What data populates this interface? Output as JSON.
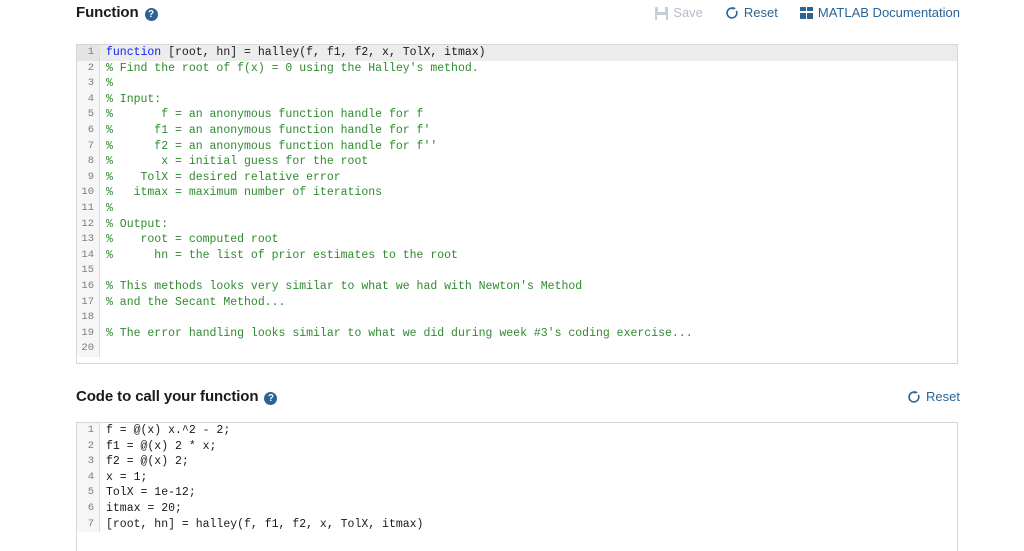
{
  "function_section": {
    "title": "Function",
    "help_icon": "help-circle-icon",
    "toolbar": {
      "save": {
        "label": "Save",
        "icon": "save-floppy-icon",
        "enabled": false
      },
      "reset": {
        "label": "Reset",
        "icon": "reset-circular-arrow-icon",
        "enabled": true
      },
      "docs": {
        "label": "MATLAB Documentation",
        "icon": "matlab-documentation-grid-icon",
        "enabled": true
      }
    },
    "accent_color": "#2a6496",
    "disabled_color": "#b3bfc9",
    "editor": {
      "active_line": 1,
      "lines": [
        {
          "n": "1",
          "tokens": [
            {
              "t": "function",
              "c": "kw"
            },
            {
              "t": " [root, hn] = halley(f, f1, f2, x, TolX, itmax)",
              "c": "txt"
            }
          ]
        },
        {
          "n": "2",
          "tokens": [
            {
              "t": "% Find the root of f(x) = 0 using the Halley's method.",
              "c": "com"
            }
          ]
        },
        {
          "n": "3",
          "tokens": [
            {
              "t": "%",
              "c": "com"
            }
          ]
        },
        {
          "n": "4",
          "tokens": [
            {
              "t": "% Input:",
              "c": "com"
            }
          ]
        },
        {
          "n": "5",
          "tokens": [
            {
              "t": "%       f = an anonymous function handle for f",
              "c": "com"
            }
          ]
        },
        {
          "n": "6",
          "tokens": [
            {
              "t": "%      f1 = an anonymous function handle for f'",
              "c": "com"
            }
          ]
        },
        {
          "n": "7",
          "tokens": [
            {
              "t": "%      f2 = an anonymous function handle for f''",
              "c": "com"
            }
          ]
        },
        {
          "n": "8",
          "tokens": [
            {
              "t": "%       x = initial guess for the root",
              "c": "com"
            }
          ]
        },
        {
          "n": "9",
          "tokens": [
            {
              "t": "%    TolX = desired relative error",
              "c": "com"
            }
          ]
        },
        {
          "n": "10",
          "tokens": [
            {
              "t": "%   itmax = maximum number of iterations",
              "c": "com"
            }
          ]
        },
        {
          "n": "11",
          "tokens": [
            {
              "t": "%",
              "c": "com"
            }
          ]
        },
        {
          "n": "12",
          "tokens": [
            {
              "t": "% Output:",
              "c": "com"
            }
          ]
        },
        {
          "n": "13",
          "tokens": [
            {
              "t": "%    root = computed root",
              "c": "com"
            }
          ]
        },
        {
          "n": "14",
          "tokens": [
            {
              "t": "%      hn = the list of prior estimates to the root",
              "c": "com"
            }
          ]
        },
        {
          "n": "15",
          "tokens": [
            {
              "t": "",
              "c": "txt"
            }
          ]
        },
        {
          "n": "16",
          "tokens": [
            {
              "t": "% This methods looks very similar to what we had with Newton's Method",
              "c": "com"
            }
          ]
        },
        {
          "n": "17",
          "tokens": [
            {
              "t": "% and the Secant Method...",
              "c": "com"
            }
          ]
        },
        {
          "n": "18",
          "tokens": [
            {
              "t": "",
              "c": "txt"
            }
          ]
        },
        {
          "n": "19",
          "tokens": [
            {
              "t": "% The error handling looks similar to what we did during week #3's coding exercise...",
              "c": "com"
            }
          ]
        },
        {
          "n": "20",
          "tokens": [
            {
              "t": "",
              "c": "txt"
            }
          ]
        }
      ]
    }
  },
  "call_section": {
    "title": "Code to call your function",
    "help_icon": "help-circle-icon",
    "toolbar": {
      "reset": {
        "label": "Reset",
        "icon": "reset-circular-arrow-icon",
        "enabled": true
      }
    },
    "editor": {
      "active_line": 0,
      "lines": [
        {
          "n": "1",
          "tokens": [
            {
              "t": "f = @(x) x.^2 - 2;",
              "c": "txt"
            }
          ]
        },
        {
          "n": "2",
          "tokens": [
            {
              "t": "f1 = @(x) 2 * x;",
              "c": "txt"
            }
          ]
        },
        {
          "n": "3",
          "tokens": [
            {
              "t": "f2 = @(x) 2;",
              "c": "txt"
            }
          ]
        },
        {
          "n": "4",
          "tokens": [
            {
              "t": "x = 1;",
              "c": "txt"
            }
          ]
        },
        {
          "n": "5",
          "tokens": [
            {
              "t": "TolX = 1e-12;",
              "c": "txt"
            }
          ]
        },
        {
          "n": "6",
          "tokens": [
            {
              "t": "itmax = 20;",
              "c": "txt"
            }
          ]
        },
        {
          "n": "7",
          "tokens": [
            {
              "t": "[root, hn] = halley(f, f1, f2, x, TolX, itmax)",
              "c": "txt"
            }
          ]
        }
      ]
    }
  }
}
